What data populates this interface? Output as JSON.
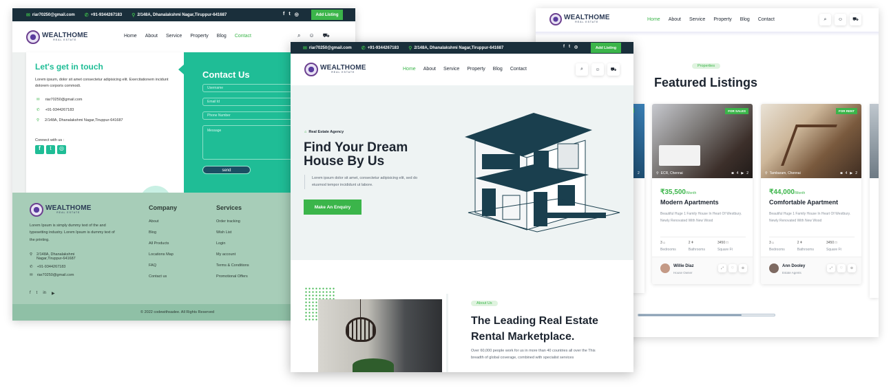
{
  "common": {
    "email": "riar70250@gmail.com",
    "phone": "+91-9344267183",
    "address": "2/148A, Dhanalakshmi Nagar,Tiruppur-641687",
    "add_listing": "Add Listing",
    "logo_main": "WEALTHOME",
    "logo_sub": "REAL ESTATE",
    "colors": {
      "green": "#3bb54a",
      "teal": "#1fbd96",
      "navy": "#1a2f3b",
      "footer": "#a7cdb8"
    }
  },
  "contact_page": {
    "nav": [
      "Home",
      "About",
      "Service",
      "Property",
      "Blog",
      "Contact"
    ],
    "touch_title": "Let's get in touch",
    "touch_text": "Lorem ipsum, dolor sit amet consectetur adipisicing elit. Exercitationem incidunt dolorem corporis commodi.",
    "connect": "Connect with us :",
    "form_title": "Contact Us",
    "username_ph": "Username",
    "email_ph": "Email Id",
    "phone_ph": "Phone Number",
    "message_ph": "Message",
    "send": "send",
    "footer_text": "Lorem Ipsum is simply dummy text of the and typesetting industry. Lorem Ipsum is dummy text of the printing.",
    "footer_address": "2/148A, Dhanalakshmi Nagar,Tiruppur-641687",
    "company_title": "Company",
    "company_links": [
      "About",
      "Blog",
      "All Products",
      "Locations Map",
      "FAQ",
      "Contact us"
    ],
    "services_title": "Services",
    "services_links": [
      "Order tracking",
      "Wish List",
      "Login",
      "My account",
      "Terms & Conditions",
      "Promotional Offers"
    ],
    "copyright": "© 2022 codewithsadee. All Rights Reserved"
  },
  "home_page": {
    "nav": [
      "Home",
      "About",
      "Service",
      "Property",
      "Blog",
      "Contact"
    ],
    "agency": "Real Estate Agency",
    "hero_title_1": "Find Your Dream",
    "hero_title_2": "House By Us",
    "hero_text": "Lorem ipsum dolor sit amet, consectetur adipisicing elit, sed do eiusmod tempor incididunt ut labore.",
    "cta": "Make An Enquiry",
    "about_badge": "About Us",
    "about_title_1": "The Leading Real Estate",
    "about_title_2": "Rental Marketplace.",
    "about_text": "Over 60,000 people work for us in more than 40 countries all over the This breadth of global coverage, combined with specialist services"
  },
  "listings_page": {
    "nav": [
      "Home",
      "About",
      "Service",
      "Property",
      "Blog",
      "Contact"
    ],
    "badge": "Properties",
    "title": "Featured Listings",
    "cards": [
      {
        "tag": "FOR SALES",
        "location": "ECR, Chennai",
        "photos": "4",
        "videos": "2",
        "price": "₹35,500",
        "per": "/Month",
        "name": "Modern Apartments",
        "desc": "Beautiful Huge 1 Family House In Heart Of Westbury. Newly Renovated With New Wood",
        "beds": "3",
        "beds_label": "Bedrooms",
        "baths": "2",
        "baths_label": "Bathrooms",
        "area": "3450",
        "area_label": "Square Ft",
        "agent": "Willie Diaz",
        "role": "House Owner"
      },
      {
        "tag": "FOR RENT",
        "location": "Tambaram, Chennai",
        "photos": "4",
        "videos": "2",
        "price": "₹44,000",
        "per": "/Month",
        "name": "Comfortable Apartment",
        "desc": "Beautiful Huge 1 Family House In Heart Of Westbury. Newly Renovated With New Wood",
        "beds": "3",
        "beds_label": "Bedrooms",
        "baths": "2",
        "baths_label": "Bathrooms",
        "area": "3450",
        "area_label": "Square Ft",
        "agent": "Ann Dooley",
        "role": "Estate Agents"
      }
    ],
    "left_partial": {
      "tag": "FOR RENT",
      "count": "2"
    }
  }
}
